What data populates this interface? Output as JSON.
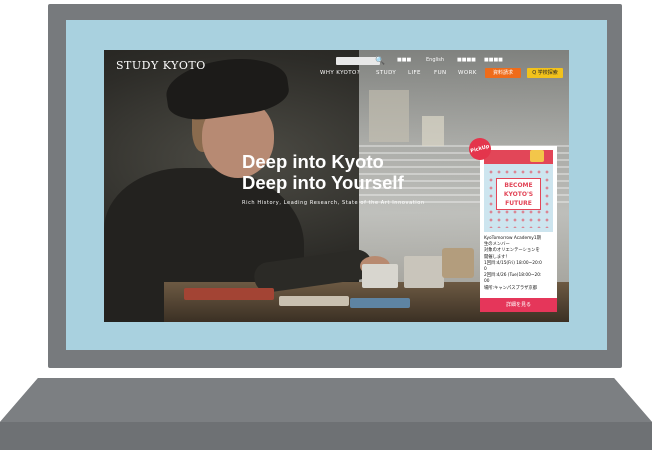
{
  "site": {
    "logo": "STUDY KYOTO",
    "utility_nav": [
      "■■■",
      "English",
      "■■■■",
      "■■■■"
    ],
    "main_nav": [
      "WHY KYOTO?",
      "STUDY",
      "LIFE",
      "FUN",
      "WORK"
    ],
    "buttons": {
      "orange": "資料請求",
      "yellow": "Q 学校探索"
    },
    "search": {
      "placeholder": ""
    }
  },
  "hero": {
    "title_line1": "Deep into Kyoto",
    "title_line2": "Deep into Yourself",
    "subtitle": "Rich History, Leading Research, State of the Art Innovation"
  },
  "pickup": {
    "badge": "PickUp",
    "poster_label": "KyoTomorrow Academy",
    "poster_text": "BECOME KYOTO'S FUTURE",
    "card_lines": [
      "KyoTomorrow Academy1期",
      "生のメンバー",
      "対象のオリエンテーションを",
      "開催します！",
      "1回目:4/15(Fri) 18:00~20:0",
      "0",
      "2回目:4/26 (Tue)18:00~20:",
      "00",
      "場所:キャンパスプラザ京都"
    ],
    "button": "詳細を見る"
  },
  "colors": {
    "bezel": "#777a7d",
    "screen_bg": "#a9d1df",
    "accent_orange": "#ef6c1a",
    "accent_yellow": "#f2c21b",
    "accent_pink": "#e5365a"
  }
}
